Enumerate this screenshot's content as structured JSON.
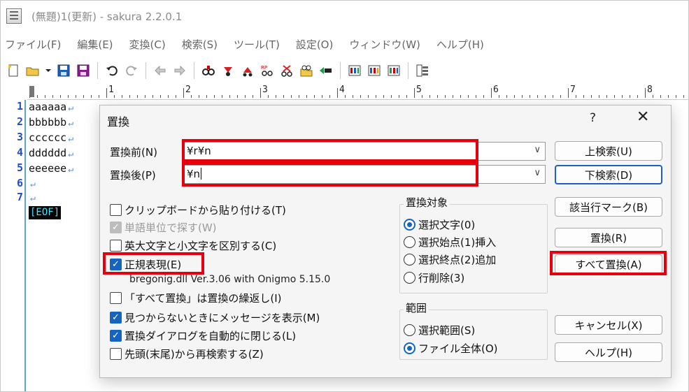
{
  "window": {
    "title": "(無題)1(更新) - sakura 2.2.0.1"
  },
  "menu": [
    "ファイル(F)",
    "編集(E)",
    "変換(C)",
    "検索(S)",
    "ツール(T)",
    "設定(O)",
    "ウィンドウ(W)",
    "ヘルプ(H)"
  ],
  "ruler": {
    "numbers": [
      "1",
      "2",
      "3",
      "4",
      "5",
      "6",
      "7",
      "8"
    ]
  },
  "editor": {
    "line_numbers": [
      "1",
      "2",
      "3",
      "4",
      "5",
      "6",
      "7"
    ],
    "lines": [
      "aaaaaa",
      "bbbbbb",
      "cccccc",
      "dddddd",
      "eeeeee",
      "",
      ""
    ],
    "return_mark": "↵",
    "eof": "[EOF]"
  },
  "dialog": {
    "title": "置換",
    "help_glyph": "?",
    "close_glyph": "✕",
    "find_label": "置換前(N)",
    "find_value": "¥r¥n",
    "replace_label": "置換後(P)",
    "replace_value": "¥n",
    "options": {
      "paste_clipboard": "クリップボードから貼り付ける(T)",
      "whole_word": "単語単位で探す(W)",
      "match_case": "英大文字と小文字を区別する(C)",
      "regex": "正規表現(E)",
      "regex_info": "bregonig.dll Ver.3.06 with Onigmo 5.15.0",
      "repeat_replace_all": "「すべて置換」は置換の繰返し(I)",
      "show_message": "見つからないときにメッセージを表示(M)",
      "auto_close": "置換ダイアログを自動的に閉じる(L)",
      "search_from_top": "先頭(末尾)から再検索する(Z)"
    },
    "target_group": {
      "title": "置換対象",
      "options": [
        "選択文字(0)",
        "選択始点(1)挿入",
        "選択終点(2)追加",
        "行削除(3)"
      ]
    },
    "scope_group": {
      "title": "範囲",
      "options": [
        "選択範囲(S)",
        "ファイル全体(O)"
      ]
    },
    "buttons": {
      "find_up": "上検索(U)",
      "find_down": "下検索(D)",
      "mark": "該当行マーク(B)",
      "replace": "置換(R)",
      "replace_all": "すべて置換(A)",
      "cancel": "キャンセル(X)",
      "help": "ヘルプ(H)"
    }
  },
  "colors": {
    "highlight": "#e6000e",
    "accent": "#1565c0",
    "line_number": "#1e4fc8"
  }
}
